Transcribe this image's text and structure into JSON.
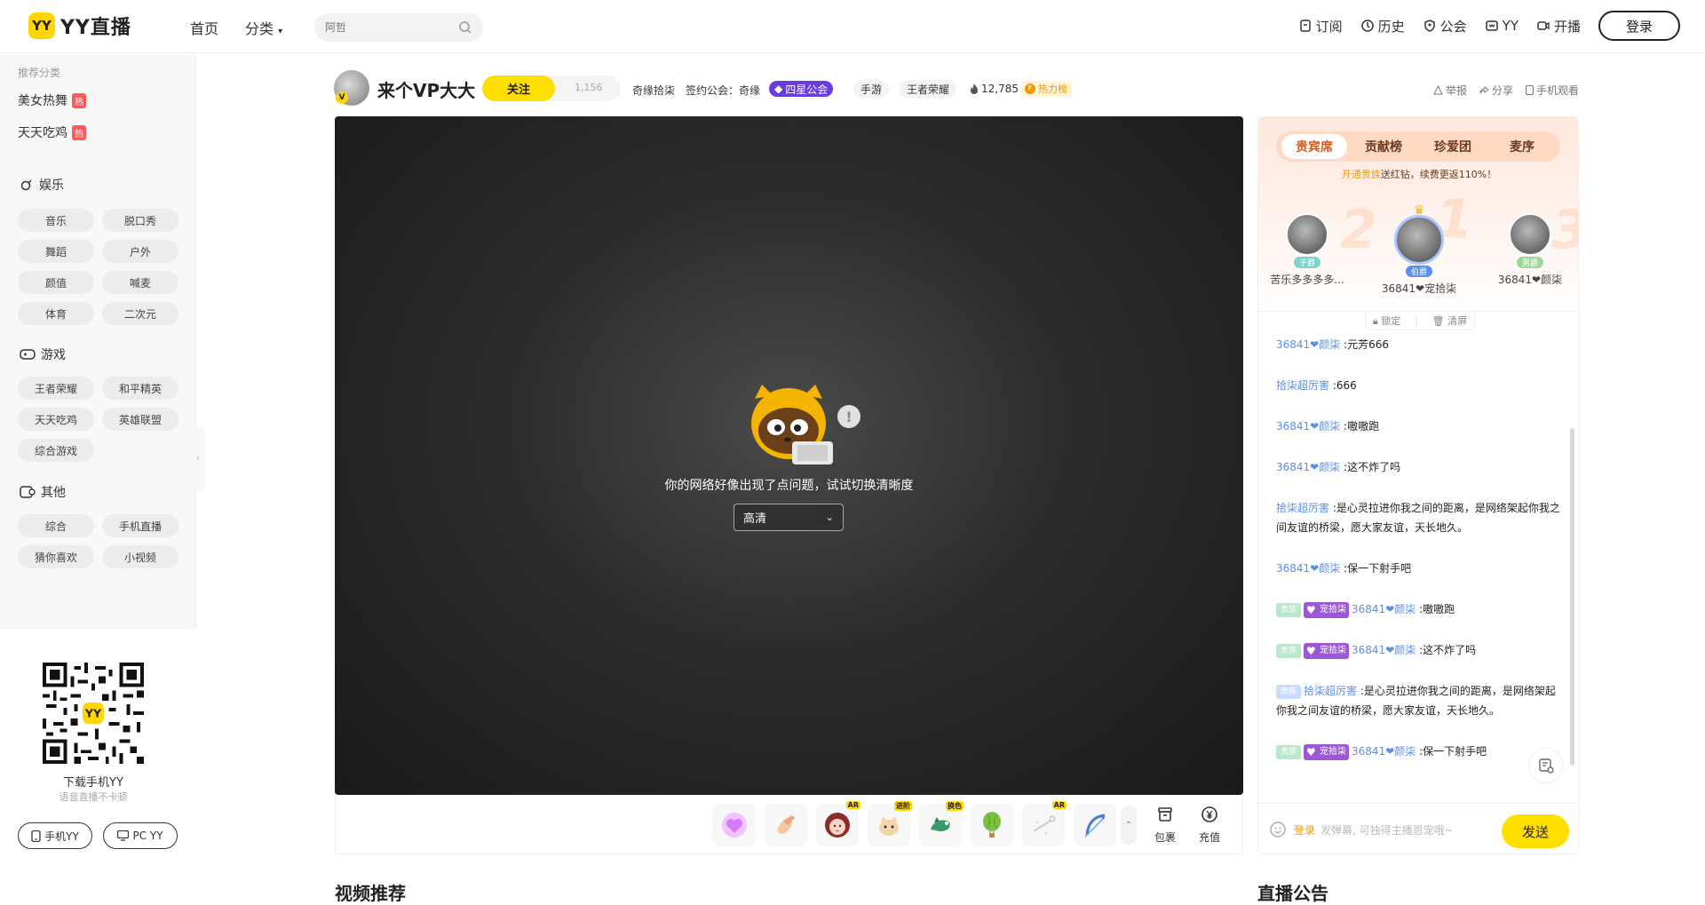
{
  "header": {
    "logo_badge": "YY",
    "logo_text": "YY直播",
    "nav_home": "首页",
    "nav_category": "分类",
    "search_placeholder": "阿哲",
    "links": [
      {
        "label": "订阅",
        "icon": "bookmark-icon"
      },
      {
        "label": "历史",
        "icon": "clock-icon"
      },
      {
        "label": "公会",
        "icon": "guild-icon"
      },
      {
        "label": "YY",
        "icon": "yy-icon"
      },
      {
        "label": "开播",
        "icon": "camera-icon"
      }
    ],
    "login": "登录"
  },
  "sidebar": {
    "recommend_title": "推荐分类",
    "recommend": [
      {
        "label": "美女热舞",
        "badge": "热"
      },
      {
        "label": "天天吃鸡",
        "badge": "热"
      }
    ],
    "sections": [
      {
        "title": "娱乐",
        "items": [
          "音乐",
          "脱口秀",
          "舞蹈",
          "户外",
          "颜值",
          "喊麦",
          "体育",
          "二次元"
        ]
      },
      {
        "title": "游戏",
        "items": [
          "王者荣耀",
          "和平精英",
          "天天吃鸡",
          "英雄联盟",
          "综合游戏"
        ]
      },
      {
        "title": "其他",
        "items": [
          "综合",
          "手机直播",
          "猜你喜欢",
          "小视频"
        ]
      }
    ],
    "qr_title": "下载手机YY",
    "qr_sub": "语音直播不卡顿",
    "btn_mobile": "手机YY",
    "btn_pc": "PC YY"
  },
  "room": {
    "avatar_badge": "V",
    "name": "来个VP大大",
    "follow": "关注",
    "follow_count": "1,156",
    "owner": "奇缘拾柒",
    "contract": "签约公会：奇缘",
    "guild_level": "四星公会",
    "tag1": "手游",
    "tag2": "王者荣耀",
    "heat": "12,785",
    "hot_list": "热力榜",
    "report": "举报",
    "share": "分享",
    "mobile_watch": "手机观看"
  },
  "video": {
    "error_message": "你的网络好像出现了点问题，试试切换清晰度",
    "quality": "高清"
  },
  "gifts": {
    "badges": [
      "",
      "",
      "AR",
      "进阶",
      "换色",
      "",
      "AR",
      ""
    ],
    "bag": "包裹",
    "recharge": "充值"
  },
  "chat": {
    "tabs": [
      "贵宾席",
      "贡献榜",
      "珍爱团",
      "麦序"
    ],
    "noble_tip_link": "开通贵族",
    "noble_tip_text": "送红钻，续费更返110%！",
    "vips": [
      {
        "name": "苦乐多多多多...",
        "rank": "子爵",
        "rank_color": "#7fd3c8"
      },
      {
        "name": "36841❤宠拾柒",
        "rank": "伯爵",
        "rank_color": "#5a8ff0"
      },
      {
        "name": "36841❤颜柒",
        "rank": "男爵",
        "rank_color": "#9fd89b"
      }
    ],
    "lock": "锁定",
    "clear": "清屏",
    "messages": [
      {
        "user": "36841❤颜柒",
        "text": "元芳666",
        "level": "",
        "fan": ""
      },
      {
        "user": "拾柒超厉害",
        "text": "666",
        "level": "",
        "fan": ""
      },
      {
        "user": "36841❤颜柒",
        "text": "嗷嗷跑",
        "level": "",
        "fan": ""
      },
      {
        "user": "36841❤颜柒",
        "text": "这不炸了吗",
        "level": "",
        "fan": ""
      },
      {
        "user": "拾柒超厉害",
        "text": "是心灵拉进你我之间的距离，是网络架起你我之间友谊的桥梁，愿大家友谊，天长地久。",
        "level": "",
        "fan": ""
      },
      {
        "user": "36841❤颜柒",
        "text": "保一下射手吧",
        "level": "",
        "fan": ""
      },
      {
        "user": "36841❤颜柒",
        "text": "嗷嗷跑",
        "level": "贵族",
        "fan": "宠拾柒"
      },
      {
        "user": "36841❤颜柒",
        "text": "这不炸了吗",
        "level": "贵族",
        "fan": "宠拾柒"
      },
      {
        "user": "拾柒超厉害",
        "text": "是心灵拉进你我之间的距离，是网络架起你我之间友谊的桥梁，愿大家友谊，天长地久。",
        "level": "贵族",
        "fan": ""
      },
      {
        "user": "36841❤颜柒",
        "text": "保一下射手吧",
        "level": "贵族",
        "fan": "宠拾柒"
      }
    ],
    "input_login": "登录",
    "input_placeholder": "发弹幕, 可独得主播恩宠哦~",
    "send": "发送"
  },
  "bottom": {
    "left_title": "视频推荐",
    "right_title": "直播公告"
  }
}
